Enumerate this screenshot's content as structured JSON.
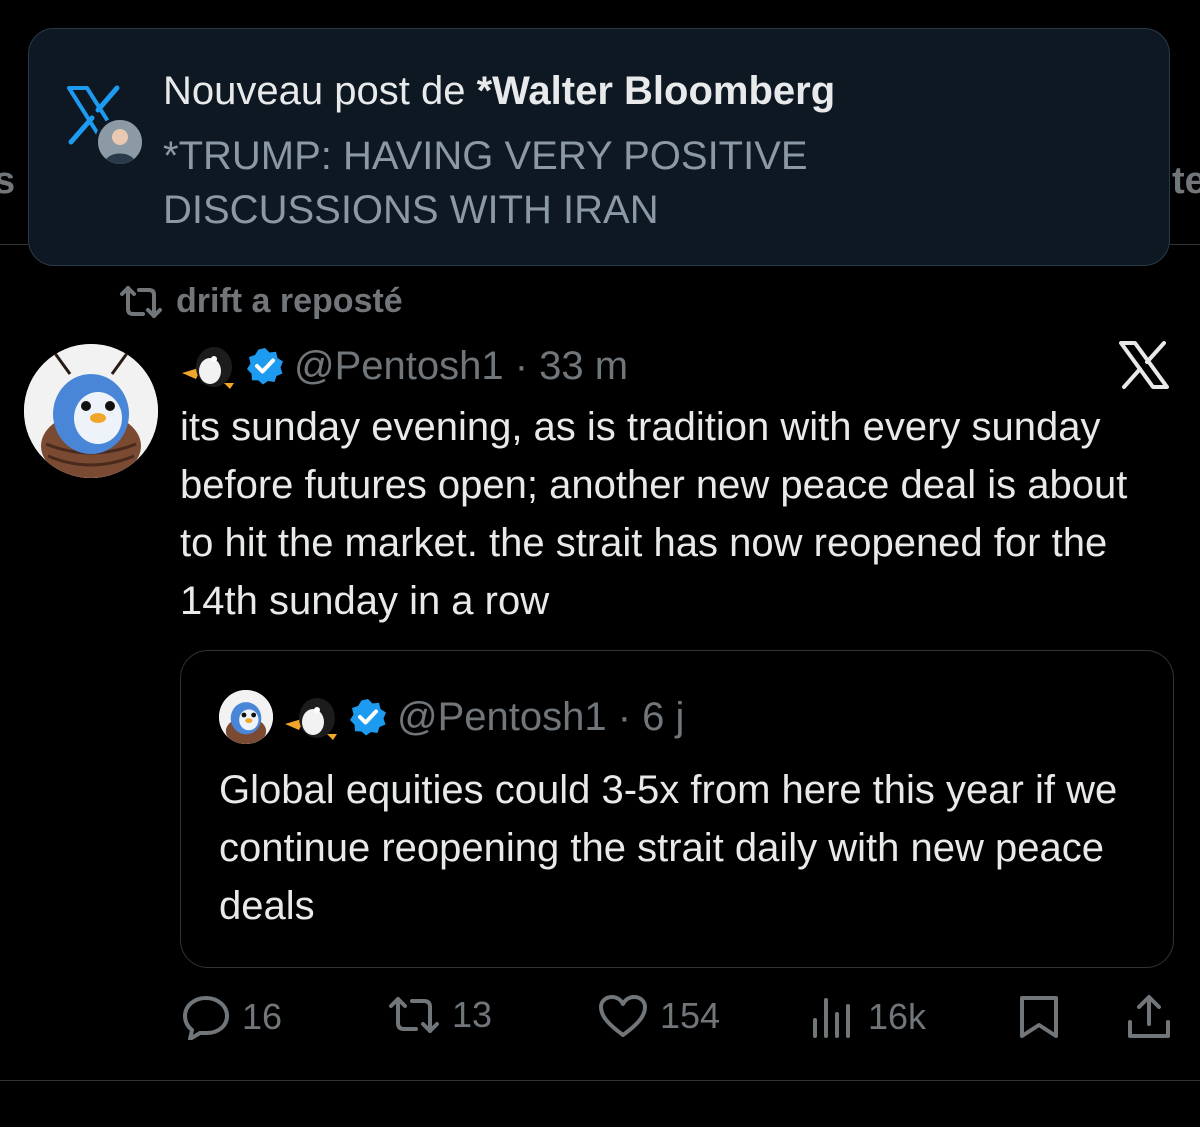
{
  "background_edges": {
    "left_fragment": "s",
    "right_fragment": "te"
  },
  "notification": {
    "prefix": "Nouveau post de",
    "author": "*Walter Bloomberg",
    "body": "*TRUMP: HAVING VERY POSITIVE DISCUSSIONS WITH IRAN"
  },
  "repost": {
    "label": "drift a reposté"
  },
  "tweet": {
    "emoji_icon": "penguin-emoji",
    "verified_icon": "verified-badge",
    "handle_time": "@Pentosh1 · 33 m",
    "text": "its sunday evening, as is tradition with every sunday before futures open; another new peace deal is about to hit the market. the strait has now reopened for the 14th sunday in a row"
  },
  "quote": {
    "handle_time": "@Pentosh1 · 6 j",
    "text": "Global equities could 3-5x from here this year if we continue reopening the strait daily with new peace deals"
  },
  "actions": {
    "replies": "16",
    "reposts": "13",
    "likes": "154",
    "views": "16k"
  },
  "colors": {
    "background": "#000000",
    "text": "#e7e9ea",
    "muted": "#71767b",
    "verified": "#1d9bf0",
    "notification_bg": "#0d1822",
    "x_logo_blue": "#1d9bf0"
  }
}
